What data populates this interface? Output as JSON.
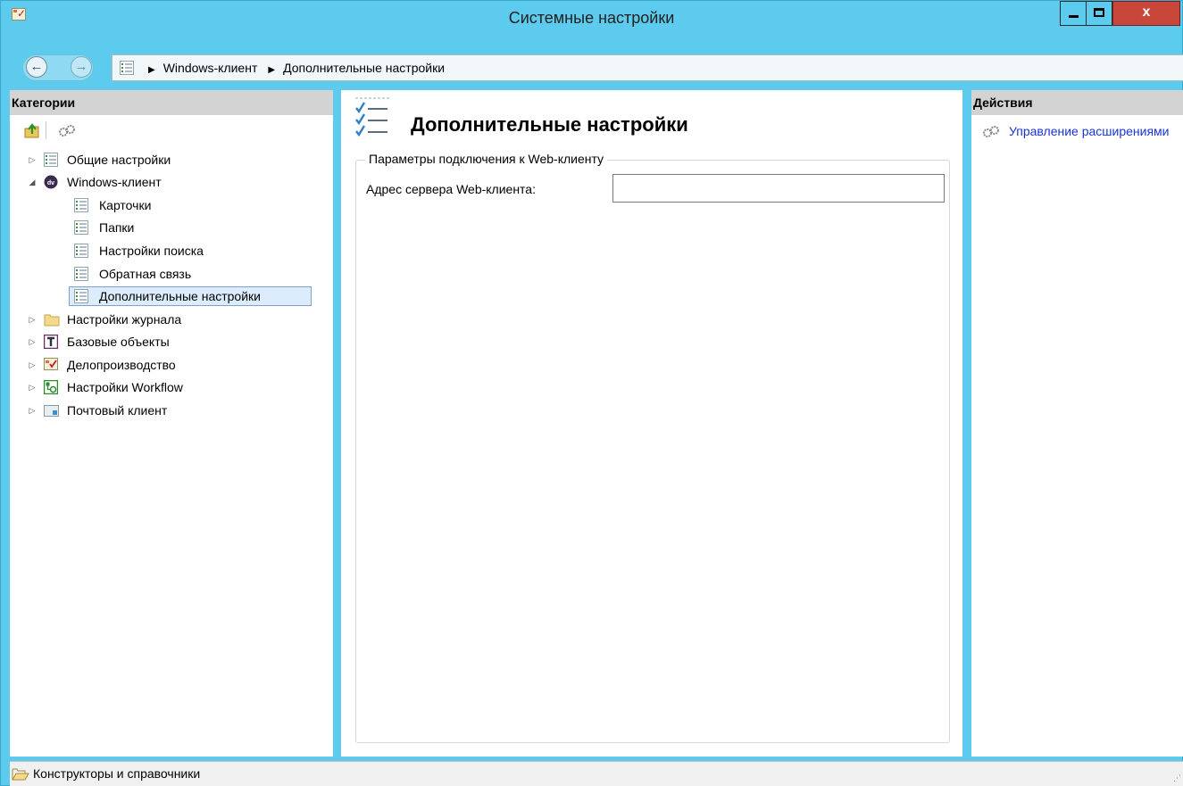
{
  "window": {
    "title": "Системные настройки"
  },
  "breadcrumb": {
    "items": [
      "Windows-клиент",
      "Дополнительные настройки"
    ]
  },
  "left_pane": {
    "header": "Категории",
    "tree": [
      {
        "label": "Общие настройки",
        "expander": "collapsed",
        "icon": "settings-list-icon"
      },
      {
        "label": "Windows-клиент",
        "expander": "expanded",
        "icon": "dv-logo-icon"
      },
      {
        "label": "Карточки",
        "expander": "none",
        "icon": "settings-list-icon"
      },
      {
        "label": "Папки",
        "expander": "none",
        "icon": "settings-list-icon"
      },
      {
        "label": "Настройки поиска",
        "expander": "none",
        "icon": "settings-list-icon"
      },
      {
        "label": "Обратная связь",
        "expander": "none",
        "icon": "settings-list-icon"
      },
      {
        "label": "Дополнительные настройки",
        "expander": "none",
        "icon": "settings-list-icon",
        "selected": true
      },
      {
        "label": "Настройки журнала",
        "expander": "collapsed",
        "icon": "folder-icon"
      },
      {
        "label": "Базовые объекты",
        "expander": "collapsed",
        "icon": "base-objects-icon"
      },
      {
        "label": "Делопроизводство",
        "expander": "collapsed",
        "icon": "office-work-icon"
      },
      {
        "label": "Настройки Workflow",
        "expander": "collapsed",
        "icon": "workflow-icon"
      },
      {
        "label": "Почтовый клиент",
        "expander": "collapsed",
        "icon": "mail-client-icon"
      }
    ]
  },
  "center_pane": {
    "title": "Дополнительные настройки",
    "group_title": "Параметры подключения к Web-клиенту",
    "field_label": "Адрес сервера Web-клиента:",
    "field_value": ""
  },
  "right_pane": {
    "header": "Действия",
    "actions": [
      {
        "label": "Управление расширениями",
        "icon": "gears-icon"
      }
    ]
  },
  "status_bar": {
    "text": "Конструкторы и справочники"
  },
  "colors": {
    "title_bar": "#5ccbee",
    "close_button": "#c9473a",
    "pane_header": "#d3d3d3",
    "selection": "#dcecfc",
    "link": "#1a33d6"
  }
}
